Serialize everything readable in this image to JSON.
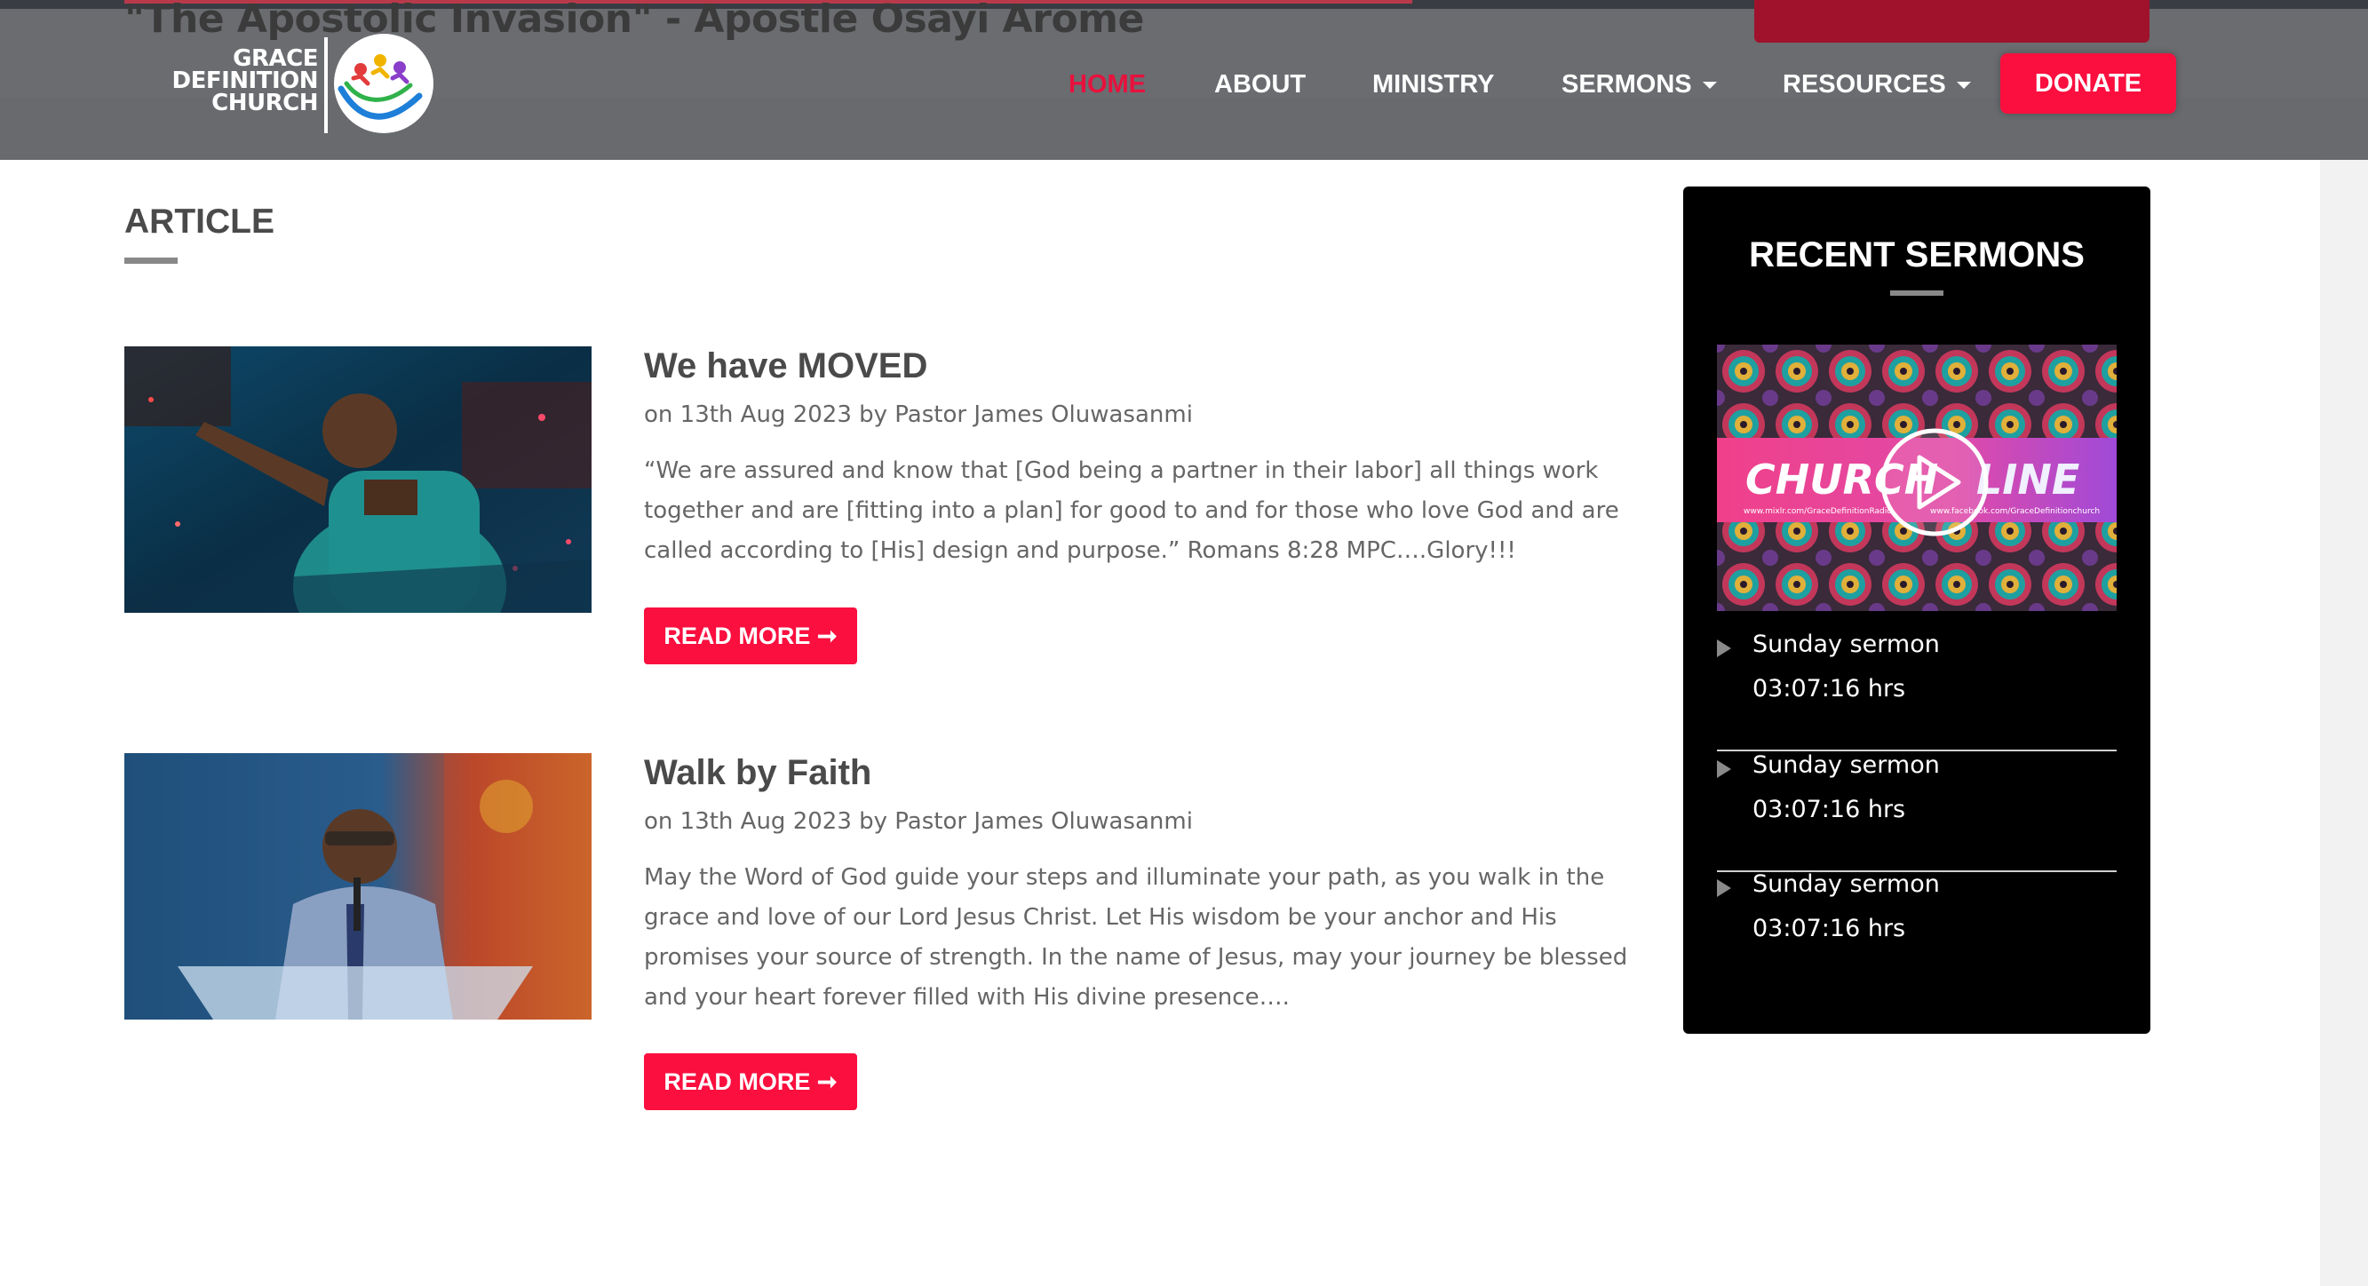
{
  "header": {
    "ticker_title": "\"The Apostolic Invasion\" - Apostle Osayi Arome",
    "logo": {
      "line1": "GRACE",
      "line2": "DEFINITION",
      "line3": "CHURCH"
    },
    "nav": [
      {
        "label": "HOME",
        "active": true,
        "dropdown": false
      },
      {
        "label": "ABOUT",
        "active": false,
        "dropdown": false
      },
      {
        "label": "MINISTRY",
        "active": false,
        "dropdown": false
      },
      {
        "label": "SERMONS",
        "active": false,
        "dropdown": true
      },
      {
        "label": "RESOURCES",
        "active": false,
        "dropdown": true
      }
    ],
    "donate_label": "DONATE"
  },
  "main": {
    "heading": "ARTICLE",
    "articles": [
      {
        "title": "We have MOVED",
        "meta": "on 13th Aug 2023 by Pastor James Oluwasanmi",
        "excerpt": "“We are assured and know that [God being a partner in their labor] all things work together and are [fitting into a plan] for good to and for those who love God and are called according to [His] design and purpose.” Romans 8:28 MPC….Glory!!!",
        "read_more": "READ MORE ➞"
      },
      {
        "title": "Walk by Faith",
        "meta": "on 13th Aug 2023 by Pastor James Oluwasanmi",
        "excerpt": "May the Word of God guide your steps and illuminate your path, as you walk in the grace and love of our Lord Jesus Christ. Let His wisdom be your anchor and His promises your source of strength. In the name of Jesus, may your journey be blessed and your heart forever filled with His divine presence….",
        "read_more": "READ MORE ➞"
      }
    ]
  },
  "sidebar": {
    "title": "RECENT SERMONS",
    "video_thumb": {
      "banner_text_left": "CHURCH",
      "banner_text_right": "LINE",
      "banner_small_left": "www.mixlr.com/GraceDefinitionRadio",
      "banner_small_right": "www.facebook.com/GraceDefinitionchurch"
    },
    "sermons": [
      {
        "title": "Sunday sermon",
        "duration": "03:07:16 hrs"
      },
      {
        "title": "Sunday sermon",
        "duration": "03:07:16 hrs"
      },
      {
        "title": "Sunday sermon",
        "duration": "03:07:16 hrs"
      }
    ]
  },
  "colors": {
    "accent": "#fa0f3f",
    "header_bg": "#6a6c70",
    "sidebar_bg": "#000000",
    "heading": "#4a4a4a",
    "text": "#666666"
  }
}
